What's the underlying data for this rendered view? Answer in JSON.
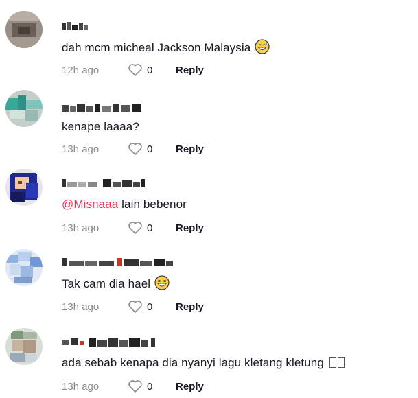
{
  "comments": [
    {
      "text": "dah mcm micheal Jackson Malaysia",
      "emoji": "sweat-smile-emoji",
      "time": "12h ago",
      "likes": "0",
      "reply": "Reply"
    },
    {
      "text": "kenape laaaa?",
      "time": "13h ago",
      "likes": "0",
      "reply": "Reply"
    },
    {
      "mention": "@Misnaaa",
      "text": " lain bebenor",
      "time": "13h ago",
      "likes": "0",
      "reply": "Reply"
    },
    {
      "text": "Tak cam dia hael",
      "emoji": "grinning-squint-emoji",
      "time": "13h ago",
      "likes": "0",
      "reply": "Reply"
    },
    {
      "text": "ada sebab kenapa dia nyanyi lagu kletang kletung",
      "emoji": "unrendered-glyph-boxes",
      "time": "13h ago",
      "likes": "0",
      "reply": "Reply"
    }
  ]
}
